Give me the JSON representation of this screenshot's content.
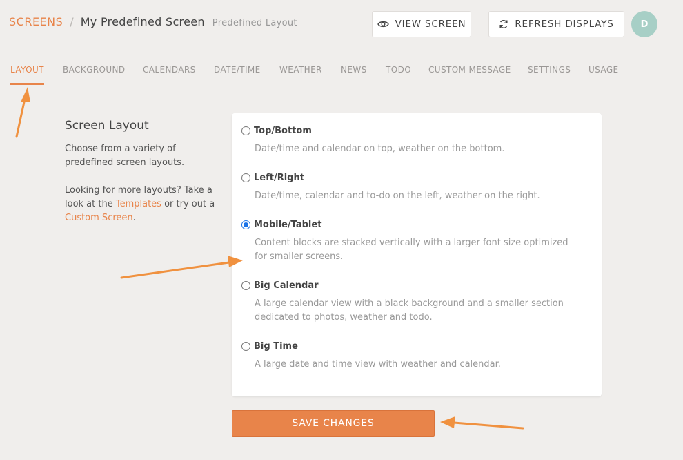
{
  "breadcrumb": {
    "root": "SCREENS",
    "separator": "/",
    "title": "My Predefined Screen",
    "subtitle": "Predefined Layout"
  },
  "header": {
    "view_screen": "VIEW SCREEN",
    "refresh_displays": "REFRESH DISPLAYS",
    "avatar_initial": "D"
  },
  "tabs": [
    {
      "label": "LAYOUT",
      "active": true
    },
    {
      "label": "BACKGROUND"
    },
    {
      "label": "CALENDARS"
    },
    {
      "label": "DATE/TIME"
    },
    {
      "label": "WEATHER"
    },
    {
      "label": "NEWS"
    },
    {
      "label": "TODO"
    },
    {
      "label": "CUSTOM MESSAGE"
    },
    {
      "label": "SETTINGS"
    },
    {
      "label": "USAGE"
    }
  ],
  "sidebar": {
    "title": "Screen Layout",
    "description": "Choose from a variety of predefined screen layouts.",
    "more_prefix": "Looking for more layouts? Take a look at the",
    "templates_link": "Templates",
    "more_middle": "or try out a",
    "custom_link": "Custom Screen",
    "more_suffix": "."
  },
  "layout_options": [
    {
      "label": "Top/Bottom",
      "description": "Date/time and calendar on top, weather on the bottom.",
      "selected": false
    },
    {
      "label": "Left/Right",
      "description": "Date/time, calendar and to-do on the left, weather on the right.",
      "selected": false
    },
    {
      "label": "Mobile/Tablet",
      "description": "Content blocks are stacked vertically with a larger font size optimized for smaller screens.",
      "selected": true
    },
    {
      "label": "Big Calendar",
      "description": "A large calendar view with a black background and a smaller section dedicated to photos, weather and todo.",
      "selected": false
    },
    {
      "label": "Big Time",
      "description": "A large date and time view with weather and calendar.",
      "selected": false
    }
  ],
  "save_button": "SAVE CHANGES",
  "colors": {
    "accent": "#e8844a",
    "avatar": "#a7cfc6",
    "radio_selected": "#1a73e8",
    "annotation_arrow": "#f0913f"
  },
  "icons": {
    "view": "eye-icon",
    "refresh": "refresh-icon"
  }
}
